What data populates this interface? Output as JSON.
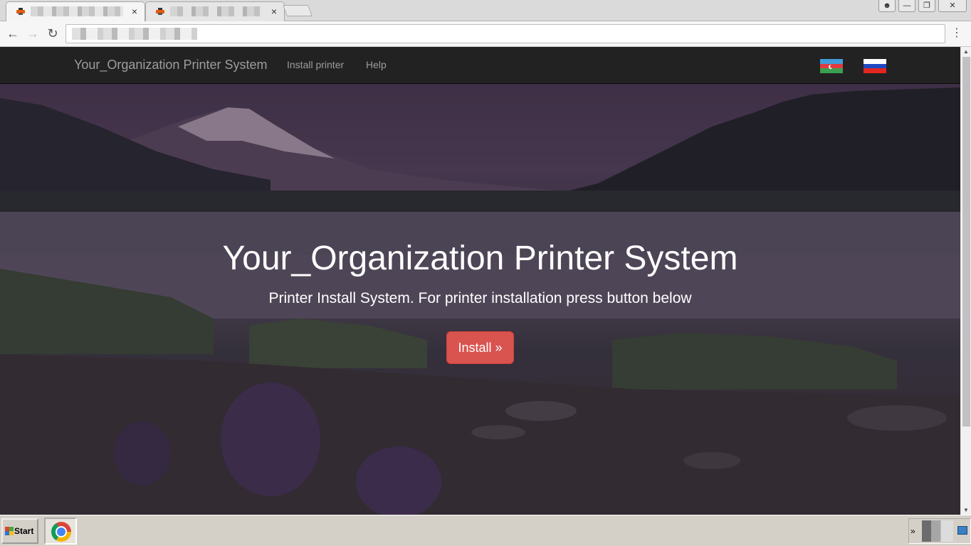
{
  "browser": {
    "tabs": [
      {
        "title": "",
        "active": true
      },
      {
        "title": "",
        "active": false
      }
    ],
    "tab_close_glyph": "×",
    "url": "",
    "nav": {
      "back_icon": "arrow-left-icon",
      "forward_icon": "arrow-right-icon",
      "reload_icon": "reload-icon"
    }
  },
  "site": {
    "brand": "Your_Organization Printer System",
    "nav_links": [
      "Install printer",
      "Help"
    ],
    "flags": [
      "azerbaijan-flag-icon",
      "russia-flag-icon"
    ]
  },
  "hero": {
    "title": "Your_Organization Printer System",
    "subtitle": "Printer Install System. For printer installation press button below",
    "install_button": "Install »"
  },
  "taskbar": {
    "start_label": "Start",
    "tray_chevron": "»"
  },
  "colors": {
    "navbar_bg": "#222222",
    "install_button_bg": "#d9534f",
    "hero_text": "#ffffff"
  }
}
